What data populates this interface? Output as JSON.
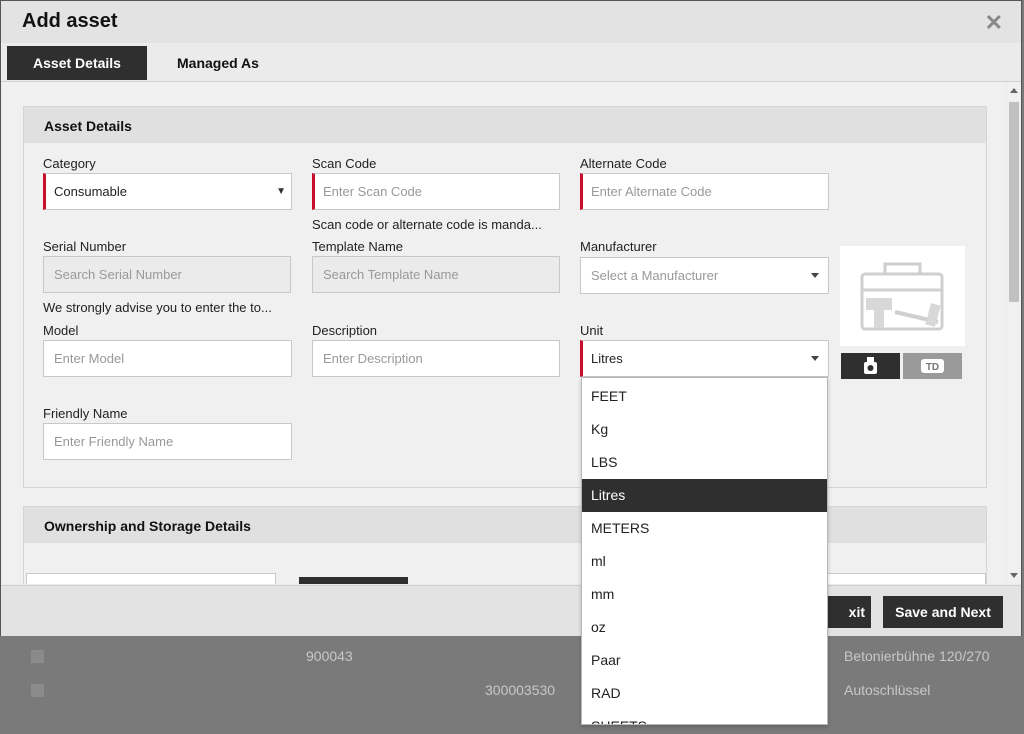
{
  "modal": {
    "title": "Add asset"
  },
  "tabs": [
    {
      "label": "Asset Details",
      "active": true
    },
    {
      "label": "Managed As",
      "active": false
    }
  ],
  "asset_details": {
    "heading": "Asset Details",
    "category": {
      "label": "Category",
      "value": "Consumable"
    },
    "scan_code": {
      "label": "Scan Code",
      "placeholder": "Enter Scan Code"
    },
    "alternate_code": {
      "label": "Alternate Code",
      "placeholder": "Enter Alternate Code"
    },
    "mandatory_hint": "Scan code or alternate code is manda...",
    "serial_number": {
      "label": "Serial Number",
      "placeholder": "Search Serial Number"
    },
    "template_name": {
      "label": "Template Name",
      "placeholder": "Search Template Name"
    },
    "manufacturer": {
      "label": "Manufacturer",
      "placeholder": "Select a Manufacturer"
    },
    "serial_hint": "We strongly advise you to enter the to...",
    "model": {
      "label": "Model",
      "placeholder": "Enter Model"
    },
    "description": {
      "label": "Description",
      "placeholder": "Enter Description"
    },
    "unit": {
      "label": "Unit",
      "value": "Litres"
    },
    "friendly_name": {
      "label": "Friendly Name",
      "placeholder": "Enter Friendly Name"
    }
  },
  "ownership": {
    "heading": "Ownership and Storage Details"
  },
  "unit_dropdown": {
    "options": [
      "FEET",
      "Kg",
      "LBS",
      "Litres",
      "METERS",
      "ml",
      "mm",
      "oz",
      "Paar",
      "RAD",
      "SHEETS"
    ],
    "selected": "Litres"
  },
  "footer": {
    "exit_label": "xit",
    "save_next_label": "Save and Next"
  },
  "background_rows": [
    {
      "id": "900043",
      "name": "Betonierbühne 120/270"
    },
    {
      "id": "300003530",
      "name": "Autoschlüssel"
    }
  ],
  "colors": {
    "dark": "#2f2f2f",
    "required": "#c8102e"
  }
}
